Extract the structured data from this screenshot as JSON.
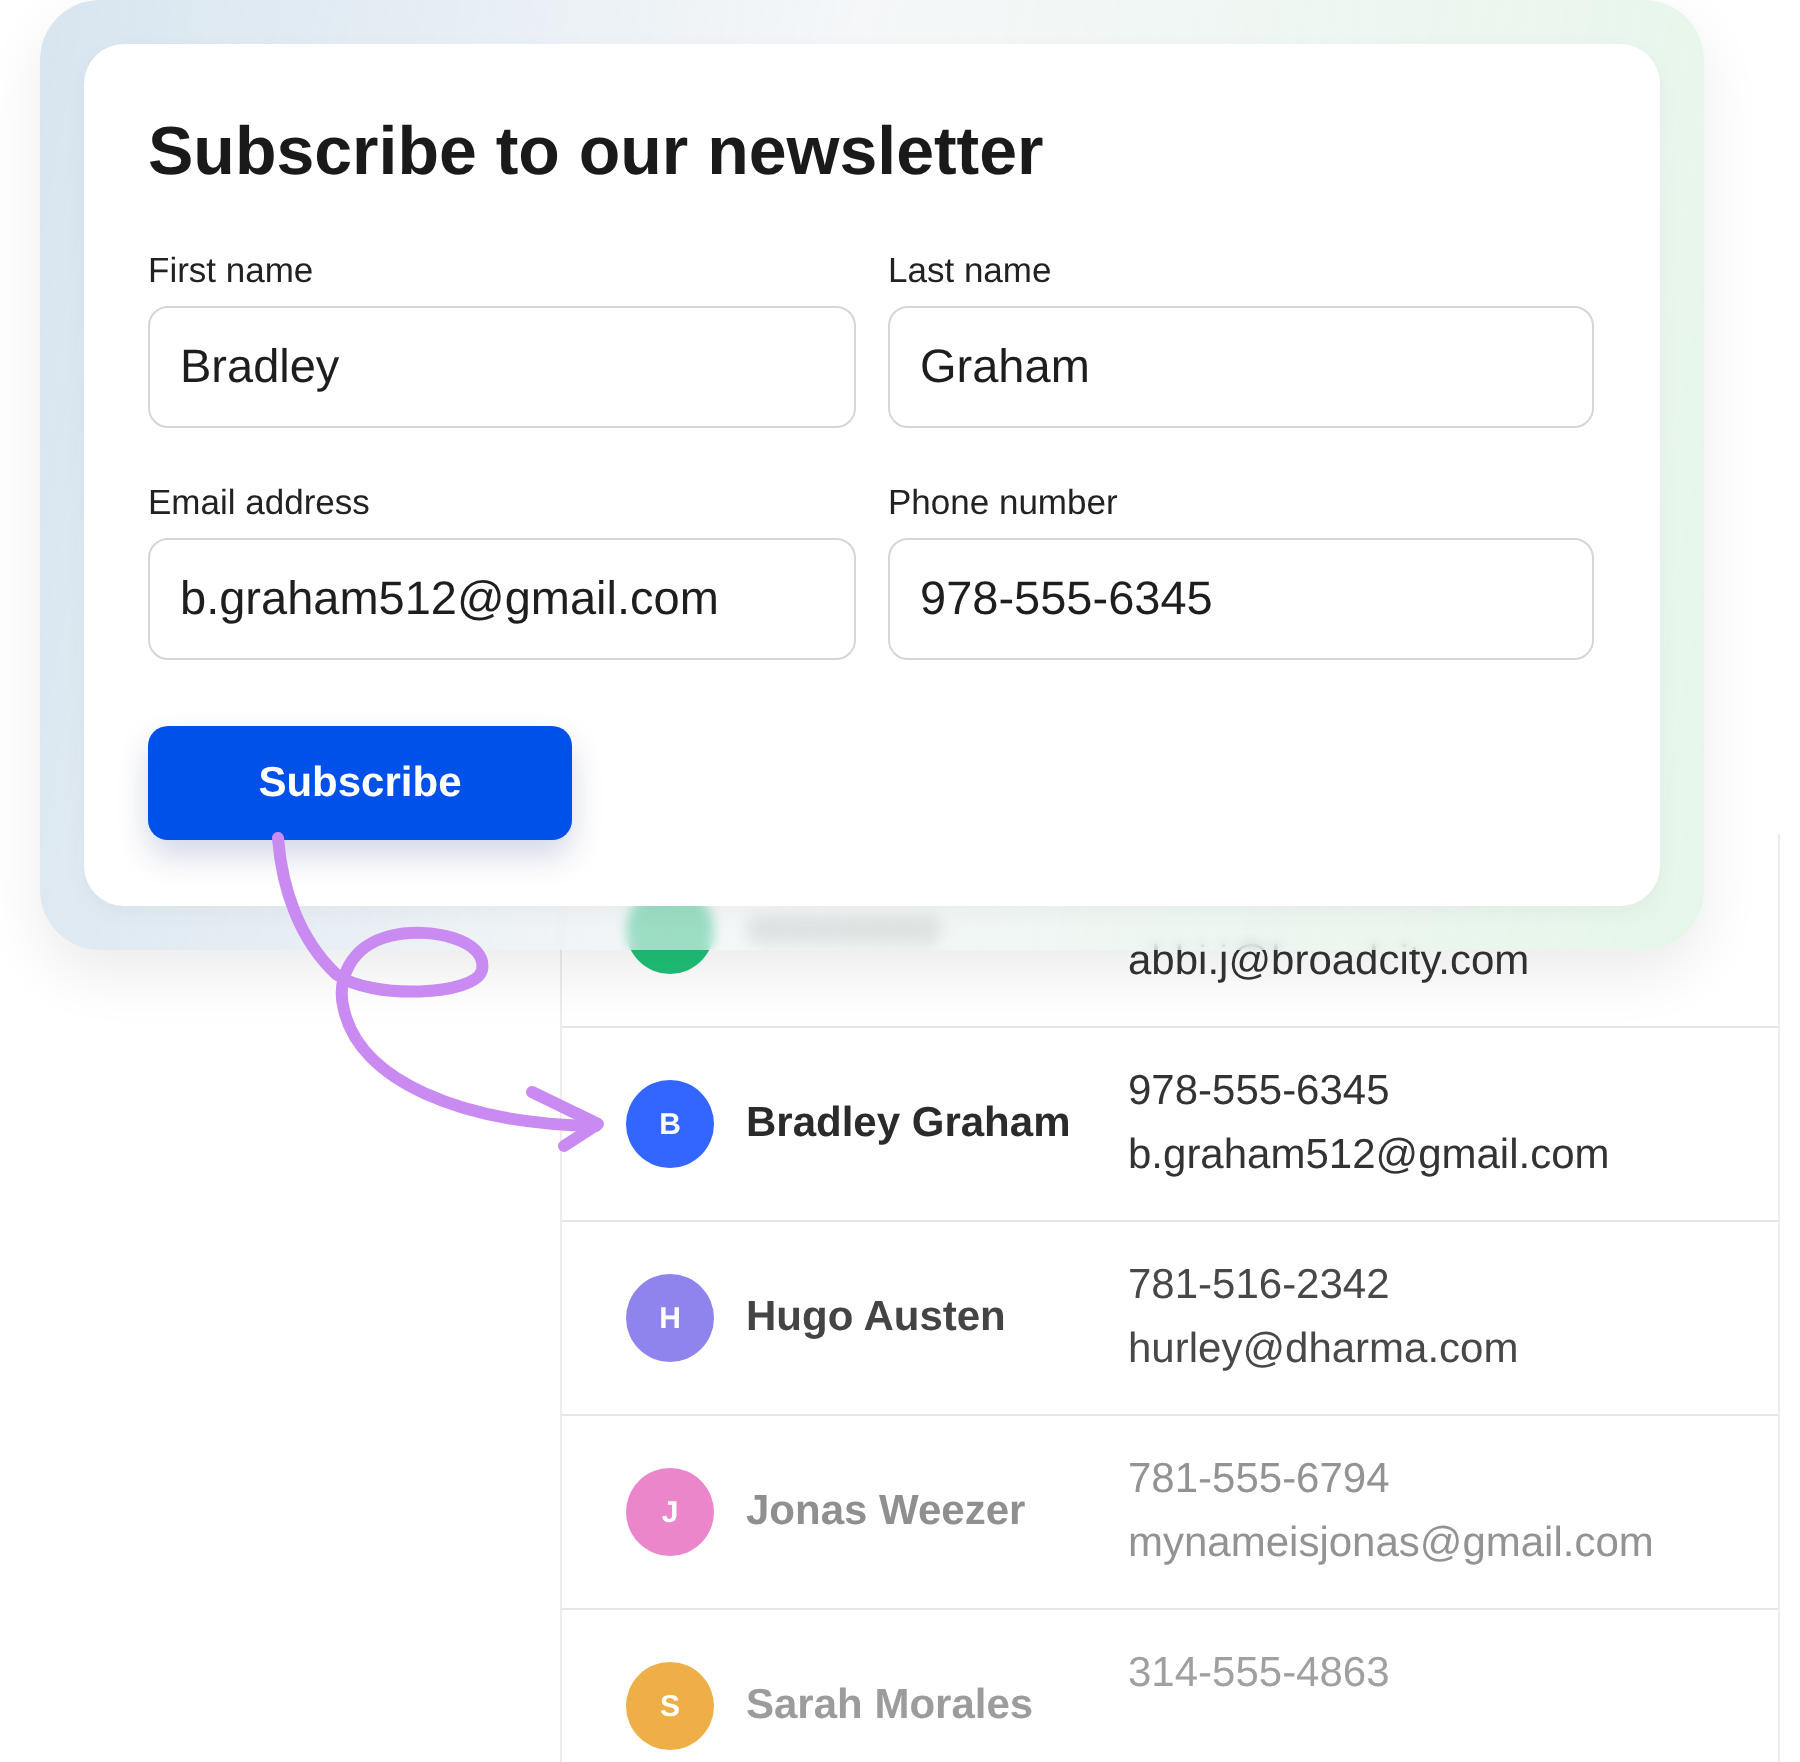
{
  "form": {
    "title": "Subscribe to our newsletter",
    "fields": [
      {
        "label": "First name",
        "value": "Bradley"
      },
      {
        "label": "Last name",
        "value": "Graham"
      },
      {
        "label": "Email address",
        "value": "b.graham512@gmail.com"
      },
      {
        "label": "Phone number",
        "value": "978-555-6345"
      }
    ],
    "submit_button": "Subscribe"
  },
  "contacts": [
    {
      "email": "abbi.j@broadcity.com",
      "color": "#1fc078"
    },
    {
      "initial": "B",
      "name": "Bradley Graham",
      "phone": "978-555-6345",
      "email": "b.graham512@gmail.com",
      "color": "#3366ff"
    },
    {
      "initial": "H",
      "name": "Hugo Austen",
      "phone": "781-516-2342",
      "email": "hurley@dharma.com",
      "color": "#8f84ee"
    },
    {
      "initial": "J",
      "name": "Jonas Weezer",
      "phone": "781-555-6794",
      "email": "mynameisjonas@gmail.com",
      "color": "#ec86cb"
    },
    {
      "initial": "S",
      "name": "Sarah Morales",
      "phone": "314-555-4863",
      "color": "#eeae48"
    }
  ]
}
